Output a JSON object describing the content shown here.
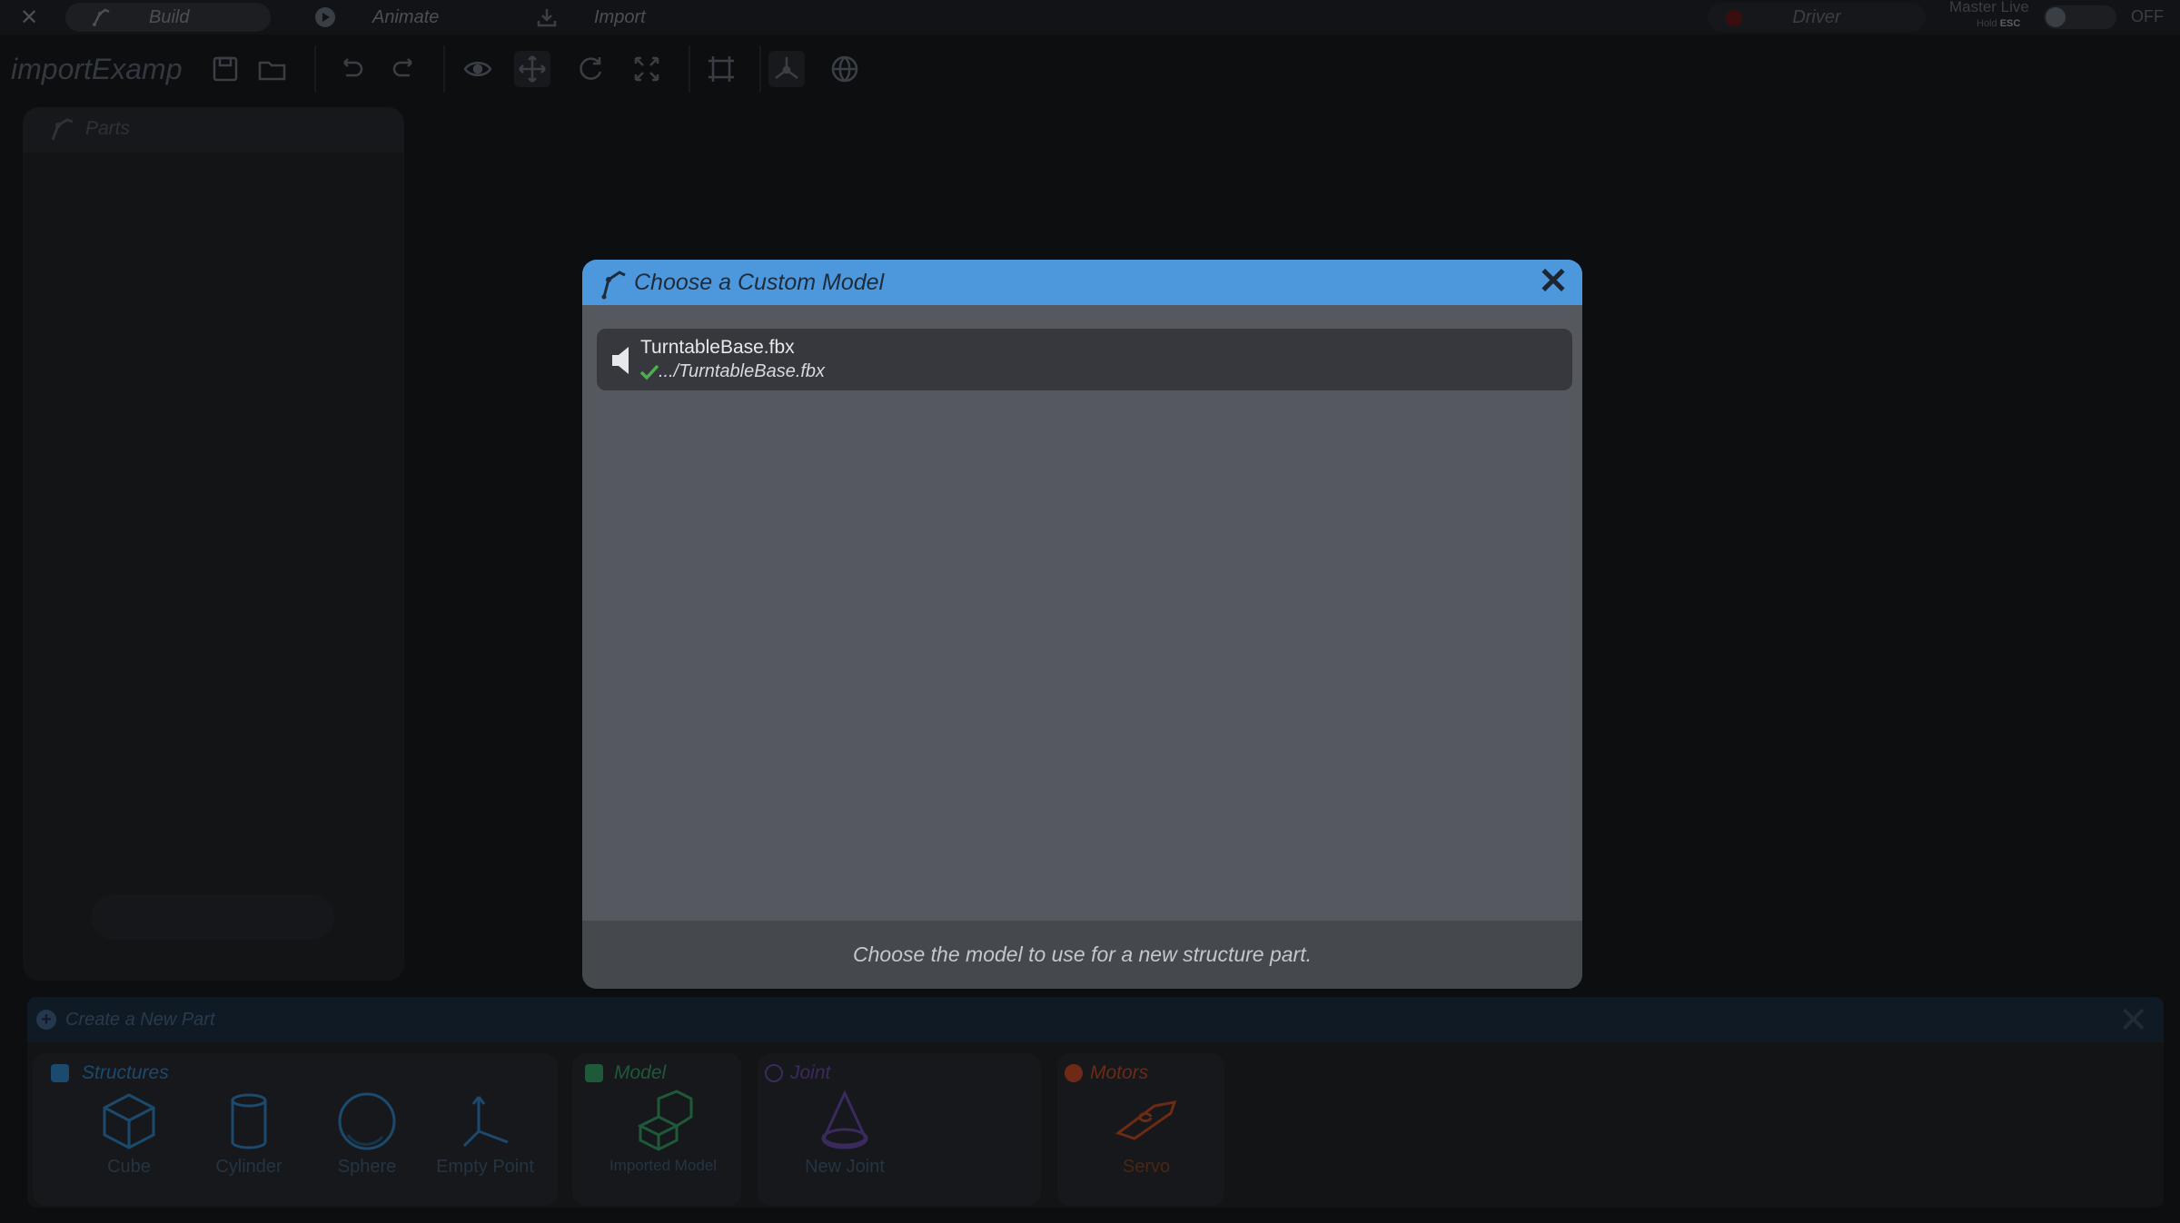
{
  "topbar": {
    "tabs": [
      {
        "label": "Build",
        "icon": "build-icon"
      },
      {
        "label": "Animate",
        "icon": "play-icon"
      },
      {
        "label": "Import",
        "icon": "import-icon"
      }
    ],
    "driver_label": "Driver",
    "master_live_label": "Master Live",
    "hold_label": "Hold",
    "esc_label": "ESC",
    "toggle_state": "OFF"
  },
  "toolbar": {
    "project_title": "importExamp",
    "icons": [
      "save-icon",
      "open-folder-icon",
      "undo-icon",
      "redo-icon",
      "eye-icon",
      "move-icon",
      "rotate-icon",
      "scale-icon",
      "frame-icon",
      "pivot-icon",
      "globe-icon"
    ]
  },
  "parts_panel": {
    "title": "Parts"
  },
  "modal": {
    "title": "Choose a Custom Model",
    "items": [
      {
        "name": "TurntableBase.fbx",
        "path": ".../TurntableBase.fbx"
      }
    ],
    "hint": "Choose the model to use for a new structure part."
  },
  "create_panel": {
    "title": "Create a New Part",
    "groups": [
      {
        "title": "Structures",
        "color": "#1c4a6e",
        "parts": [
          "Cube",
          "Cylinder",
          "Sphere",
          "Empty Point"
        ]
      },
      {
        "title": "Model",
        "color": "#1e5a3a",
        "parts": [
          "Imported Model"
        ]
      },
      {
        "title": "Joint",
        "color": "#3a2a5e",
        "parts": [
          "New Joint"
        ]
      },
      {
        "title": "Motors",
        "color": "#6e2a14",
        "parts": [
          "Servo"
        ]
      }
    ]
  },
  "colors": {
    "modal_header": "#4d98dc",
    "modal_body": "#55585e",
    "check": "#4caf50"
  }
}
